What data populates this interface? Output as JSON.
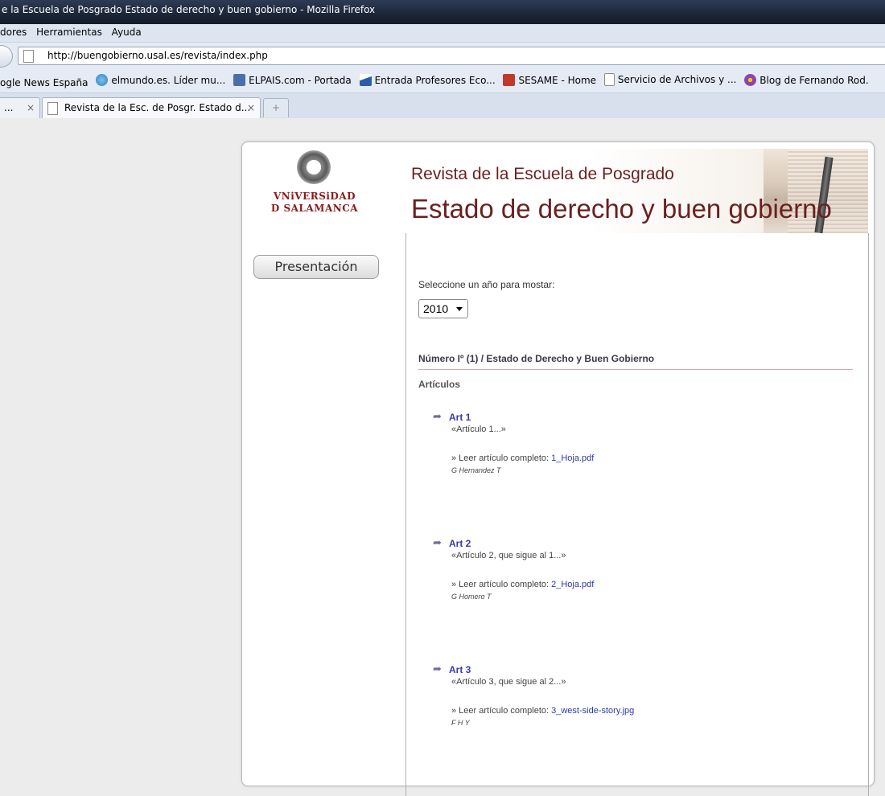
{
  "window": {
    "title": "e la Escuela de Posgrado Estado de derecho y buen gobierno - Mozilla Firefox"
  },
  "menu": {
    "items": [
      "dores",
      "Herramientas",
      "Ayuda"
    ]
  },
  "nav": {
    "url": "http://buengobierno.usal.es/revista/index.php"
  },
  "bookmarks": {
    "items": [
      {
        "label": "ogle News España",
        "icon": "google-icon",
        "color": ""
      },
      {
        "label": "elmundo.es. Líder mu...",
        "icon": "globe-icon",
        "color": "#2f7fc0"
      },
      {
        "label": "ELPAIS.com - Portada",
        "icon": "elpais-icon",
        "color": "#4a6fa8"
      },
      {
        "label": "Entrada Profesores Eco...",
        "icon": "usal-icon",
        "color": "#2a5fa8"
      },
      {
        "label": "SESAME - Home",
        "icon": "sesame-icon",
        "color": "#c0392b"
      },
      {
        "label": "Servicio de Archivos y ...",
        "icon": "page-icon",
        "color": "#ffffff"
      },
      {
        "label": "Blog de Fernando Rod.",
        "icon": "blog-icon",
        "color": "#8e44ad"
      }
    ]
  },
  "tabs": [
    {
      "label": "...",
      "close": "×"
    },
    {
      "label": "Revista de la Esc. de Posgr. Estado d...",
      "close": "×"
    }
  ],
  "newtab_symbol": "+",
  "site": {
    "university": [
      "VNiVERSiDAD",
      "D SALAMANCA"
    ],
    "header_line1": "Revista de la Escuela de Posgrado",
    "header_line2": "Estado de derecho y buen gobierno",
    "nav_button": "Presentación",
    "select_label": "Seleccione un año para mostar:",
    "year": "2010",
    "issue_title": "Número Iº (1) / Estado de Derecho y Buen Gobierno",
    "articles_heading": "Artículos",
    "read_prefix": "» Leer artículo completo: ",
    "articles": [
      {
        "title": "Art 1",
        "summary": "«Artículo 1...»",
        "file": "1_Hoja.pdf",
        "author": "G Hernandez T"
      },
      {
        "title": "Art 2",
        "summary": "«Artículo 2, que sigue al 1...»",
        "file": "2_Hoja.pdf",
        "author": "G Homero T"
      },
      {
        "title": "Art 3",
        "summary": "«Artículo 3, que sigue al 2...»",
        "file": "3_west-side-story.jpg",
        "author": "F H Y"
      }
    ]
  }
}
